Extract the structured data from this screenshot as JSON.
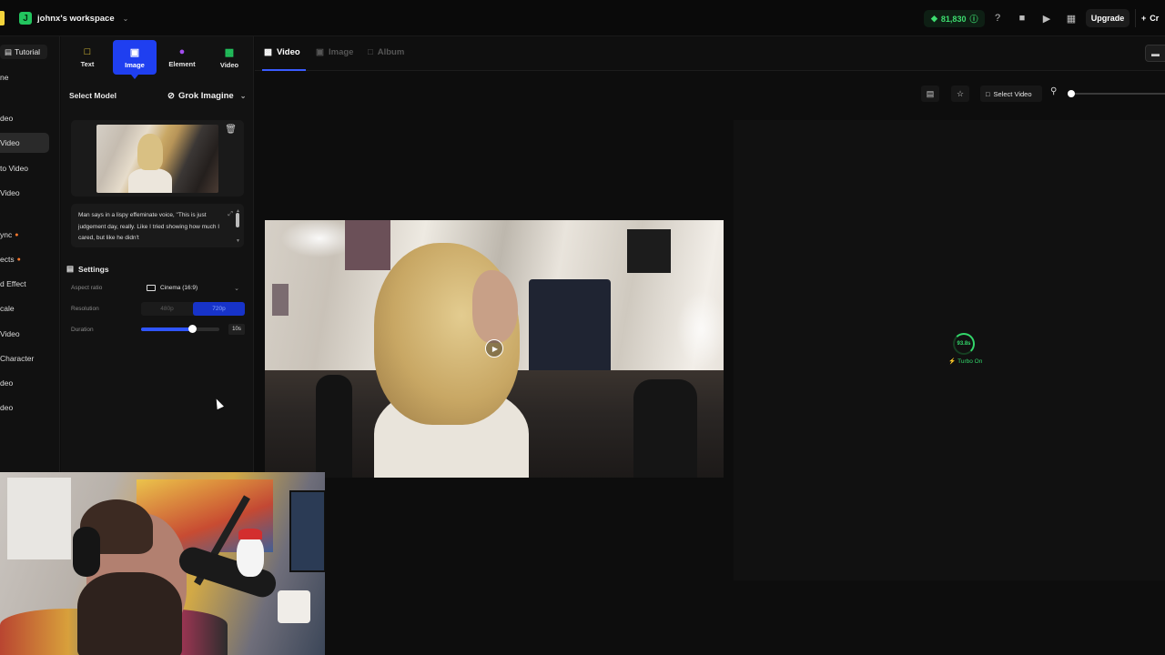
{
  "topbar": {
    "workspace_initial": "J",
    "workspace_name": "johnx's workspace",
    "credits": "81,830",
    "upgrade_label": "Upgrade",
    "create_label": "Cr"
  },
  "leftnav": {
    "tutorial_label": "Tutorial",
    "items": [
      {
        "label": "ne"
      },
      {
        "label": "deo"
      },
      {
        "label": "Video"
      },
      {
        "label": "to Video"
      },
      {
        "label": "Video"
      },
      {
        "label": "ync"
      },
      {
        "label": "ects"
      },
      {
        "label": "d Effect"
      },
      {
        "label": "cale"
      },
      {
        "label": "Video"
      },
      {
        "label": "Character"
      },
      {
        "label": "deo"
      },
      {
        "label": "deo"
      }
    ]
  },
  "panel": {
    "modes": [
      {
        "label": "Text"
      },
      {
        "label": "Image"
      },
      {
        "label": "Element"
      },
      {
        "label": "Video"
      }
    ],
    "select_model_label": "Select Model",
    "model_value": "Grok Imagine",
    "prompt_text": "Man says in a lispy effeminate voice, \"This is just judgement day, really. Like I tried showing how much I cared, but like he didn't",
    "settings_label": "Settings",
    "aspect_label": "Aspect ratio",
    "aspect_value": "Cinema (16:9)",
    "resolution_label": "Resolution",
    "resolution_options": [
      "480p",
      "720p"
    ],
    "resolution_selected": "720p",
    "duration_label": "Duration",
    "duration_value": "10s",
    "duration_fraction": 0.65
  },
  "content": {
    "tabs": [
      {
        "label": "Video",
        "active": true
      },
      {
        "label": "Image",
        "active": false
      },
      {
        "label": "Album",
        "active": false
      }
    ],
    "select_video_label": "Select Video",
    "turbo_progress": "93.8s",
    "turbo_label": "Turbo On"
  },
  "colors": {
    "accent": "#1f3ff0",
    "credit_green": "#3ddc6f",
    "background": "#0d0d0d"
  }
}
